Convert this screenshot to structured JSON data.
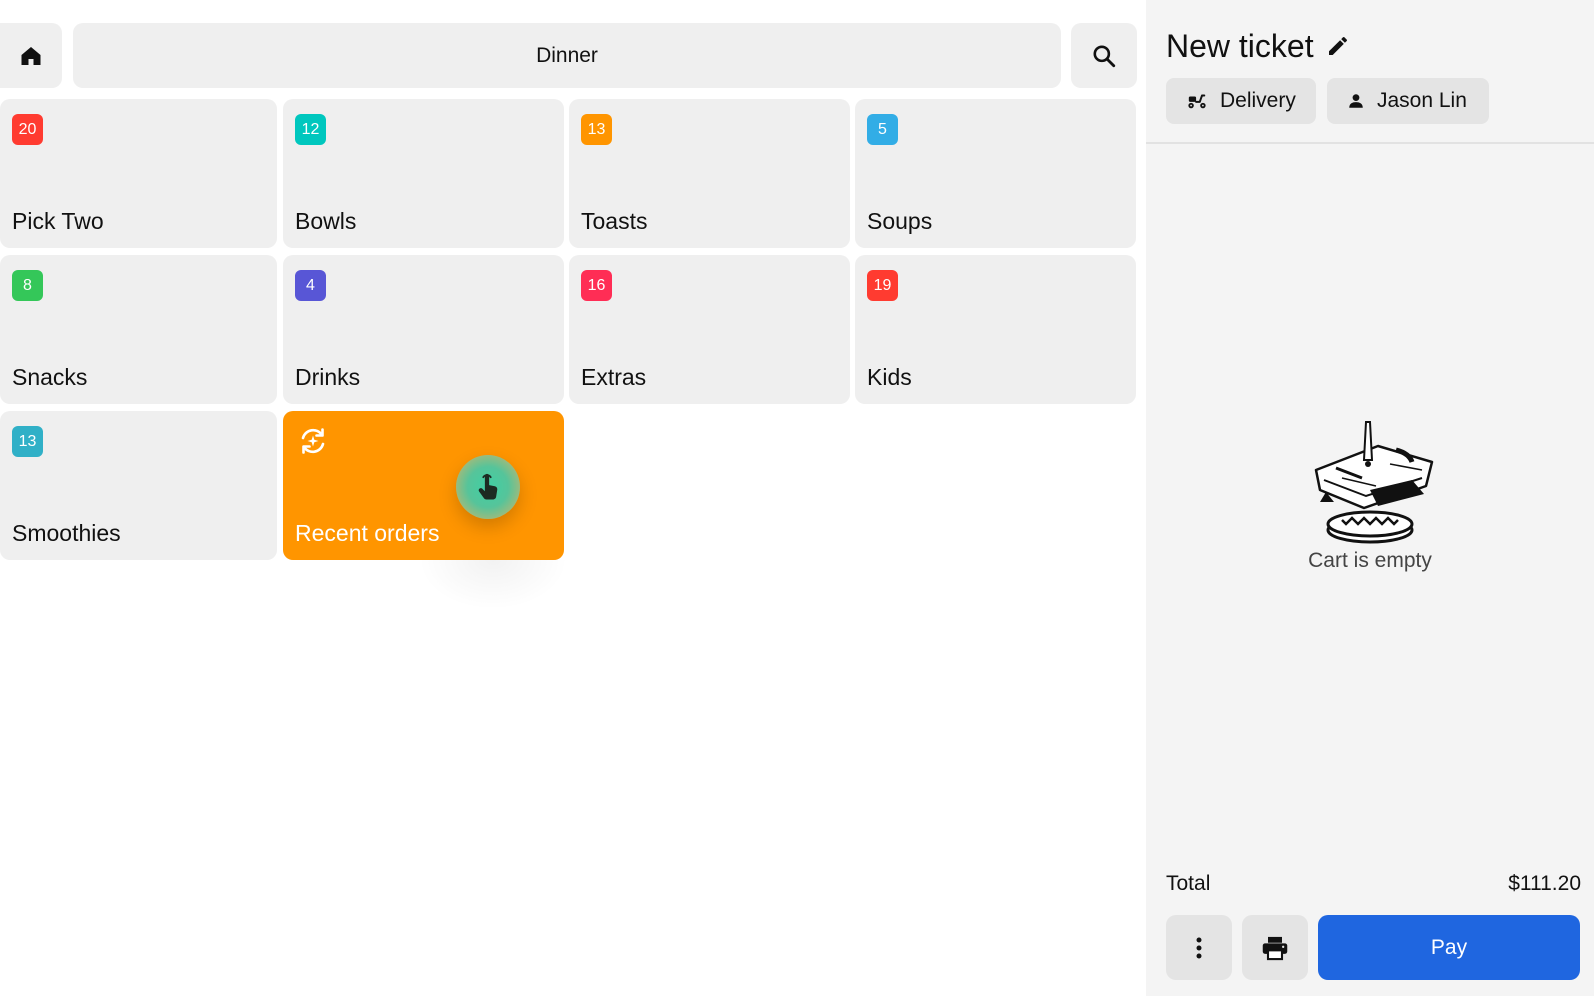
{
  "header": {
    "title": "Dinner",
    "home_icon": "home-icon",
    "search_icon": "search-icon"
  },
  "categories": [
    {
      "label": "Pick Two",
      "count": "20",
      "color": "#ff3b30"
    },
    {
      "label": "Bowls",
      "count": "12",
      "color": "#00c7be"
    },
    {
      "label": "Toasts",
      "count": "13",
      "color": "#ff9500"
    },
    {
      "label": "Soups",
      "count": "5",
      "color": "#32ade6"
    },
    {
      "label": "Snacks",
      "count": "8",
      "color": "#34c759"
    },
    {
      "label": "Drinks",
      "count": "4",
      "color": "#5856d6"
    },
    {
      "label": "Extras",
      "count": "16",
      "color": "#ff2d55"
    },
    {
      "label": "Kids",
      "count": "19",
      "color": "#ff3b30"
    },
    {
      "label": "Smoothies",
      "count": "13",
      "color": "#30b0c7"
    }
  ],
  "recent": {
    "label": "Recent orders",
    "color": "#ff9500",
    "icon": "recent-orders-icon"
  },
  "ticket": {
    "title": "New ticket",
    "edit_icon": "pencil-icon",
    "order_type": "Delivery",
    "order_type_icon": "scooter-icon",
    "customer": "Jason Lin",
    "customer_icon": "person-icon",
    "empty_message": "Cart is empty",
    "total_label": "Total",
    "total_value": "$111.20",
    "more_icon": "more-vertical-icon",
    "print_icon": "printer-icon",
    "pay_label": "Pay",
    "pay_color": "#1f66e0"
  }
}
